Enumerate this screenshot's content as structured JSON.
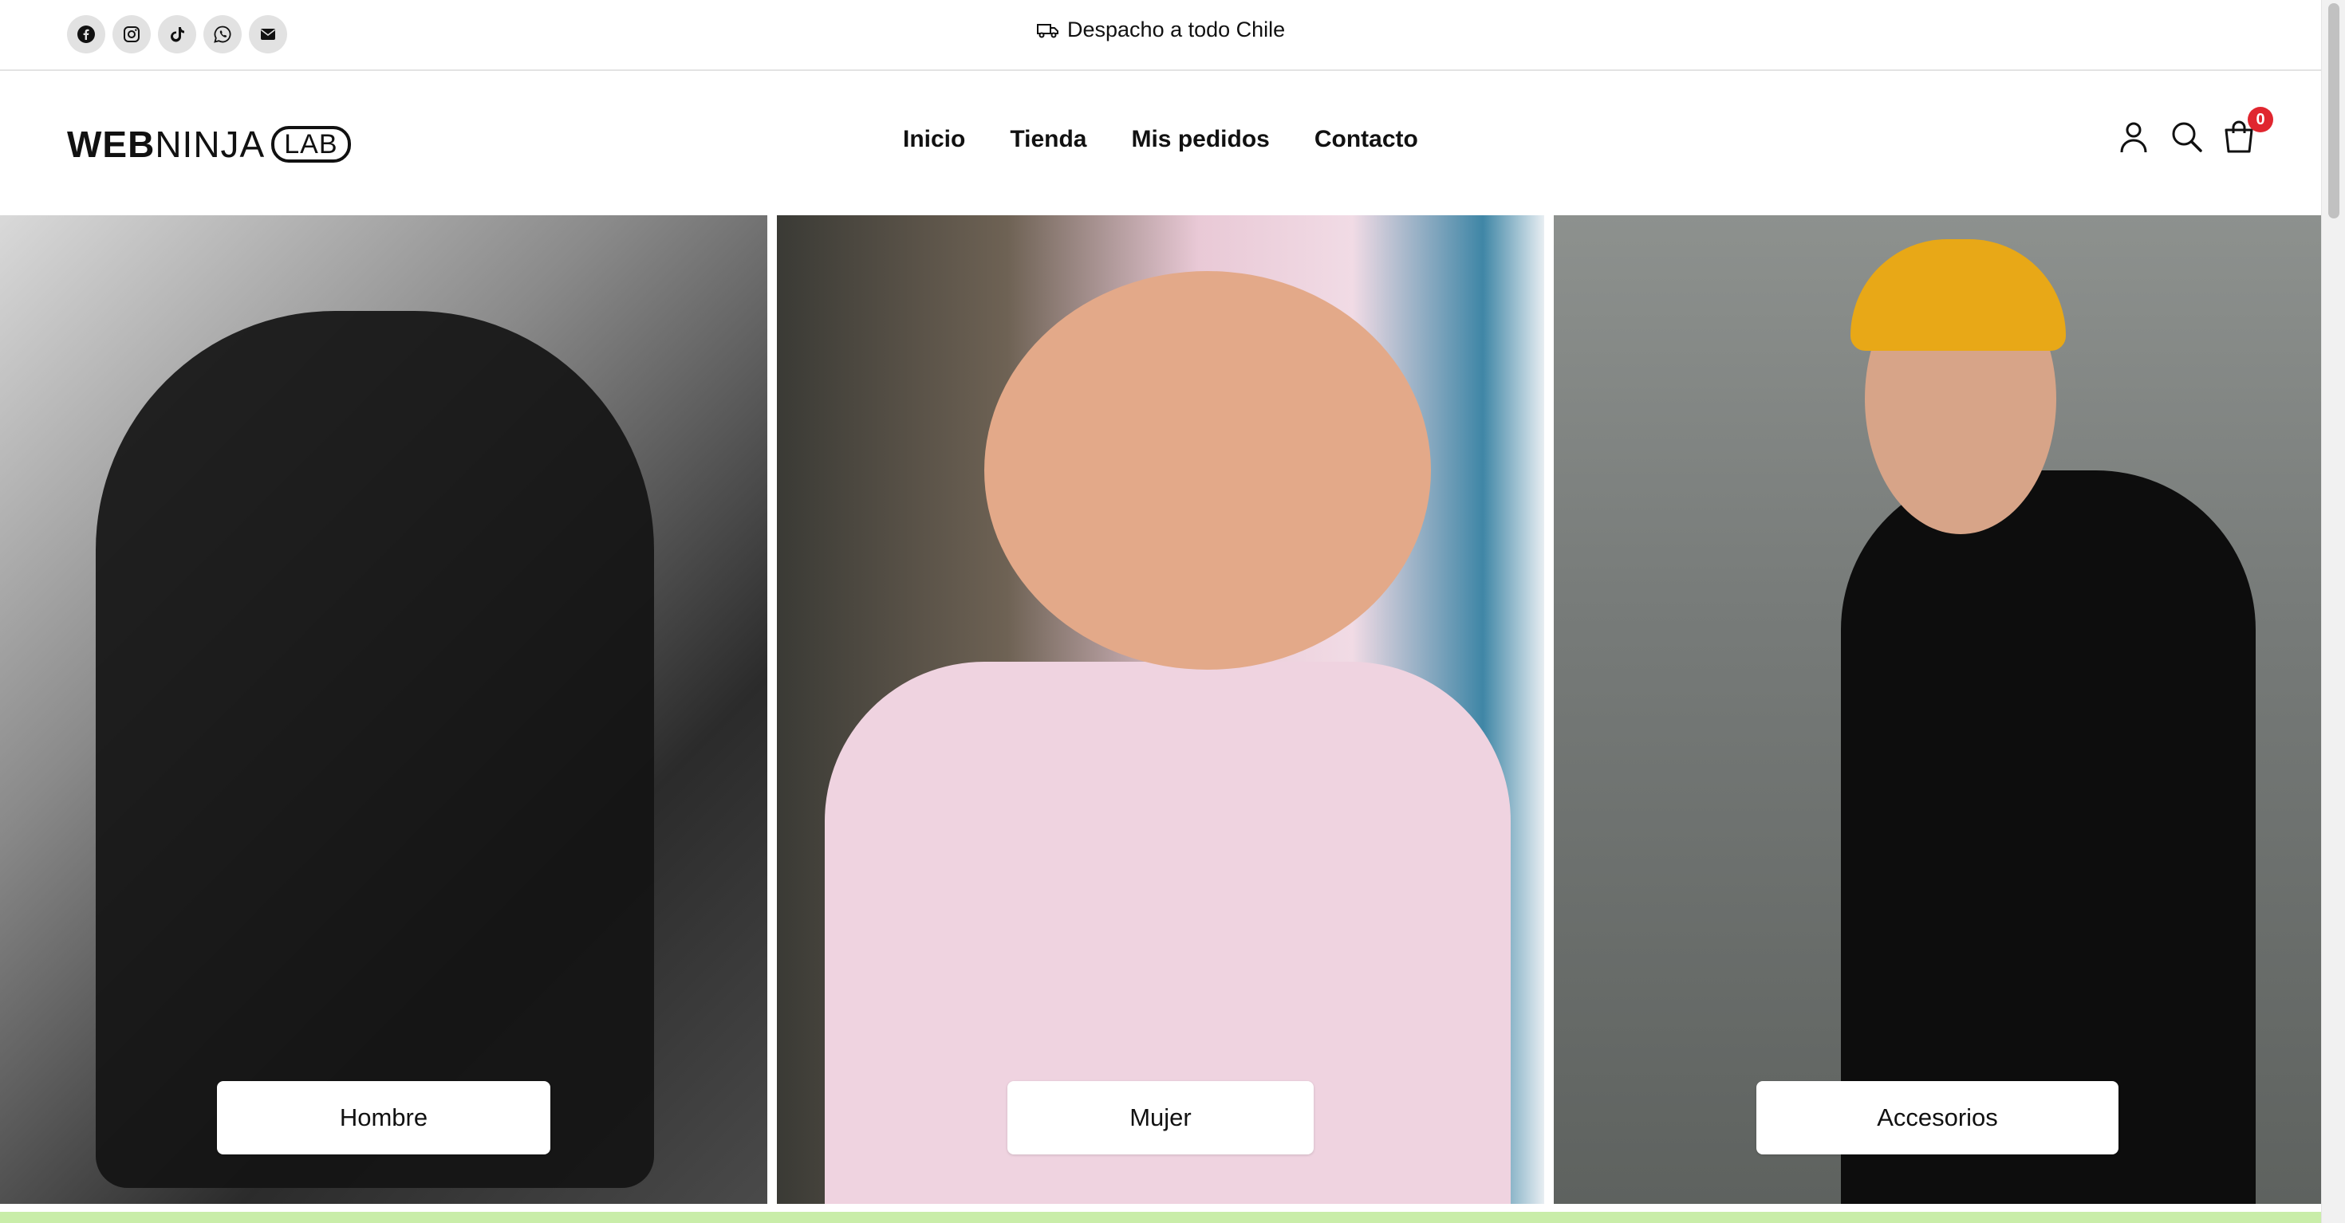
{
  "topbar": {
    "socials": [
      {
        "name": "facebook-icon"
      },
      {
        "name": "instagram-icon"
      },
      {
        "name": "tiktok-icon"
      },
      {
        "name": "whatsapp-icon"
      },
      {
        "name": "email-icon"
      }
    ],
    "announcement_icon": "truck-icon",
    "announcement": "Despacho a todo Chile"
  },
  "header": {
    "logo": {
      "part1": "WEB",
      "part2": "NINJA",
      "part3": "LAB"
    },
    "nav": [
      "Inicio",
      "Tienda",
      "Mis pedidos",
      "Contacto"
    ],
    "icons": [
      "user-icon",
      "search-icon",
      "cart-icon"
    ],
    "cart_count": "0"
  },
  "categories": [
    {
      "label": "Hombre"
    },
    {
      "label": "Mujer"
    },
    {
      "label": "Accesorios"
    }
  ],
  "colors": {
    "badge": "#e0262f",
    "bottom_strip": "#c9eda9",
    "accent_hat": "#e8a817"
  }
}
